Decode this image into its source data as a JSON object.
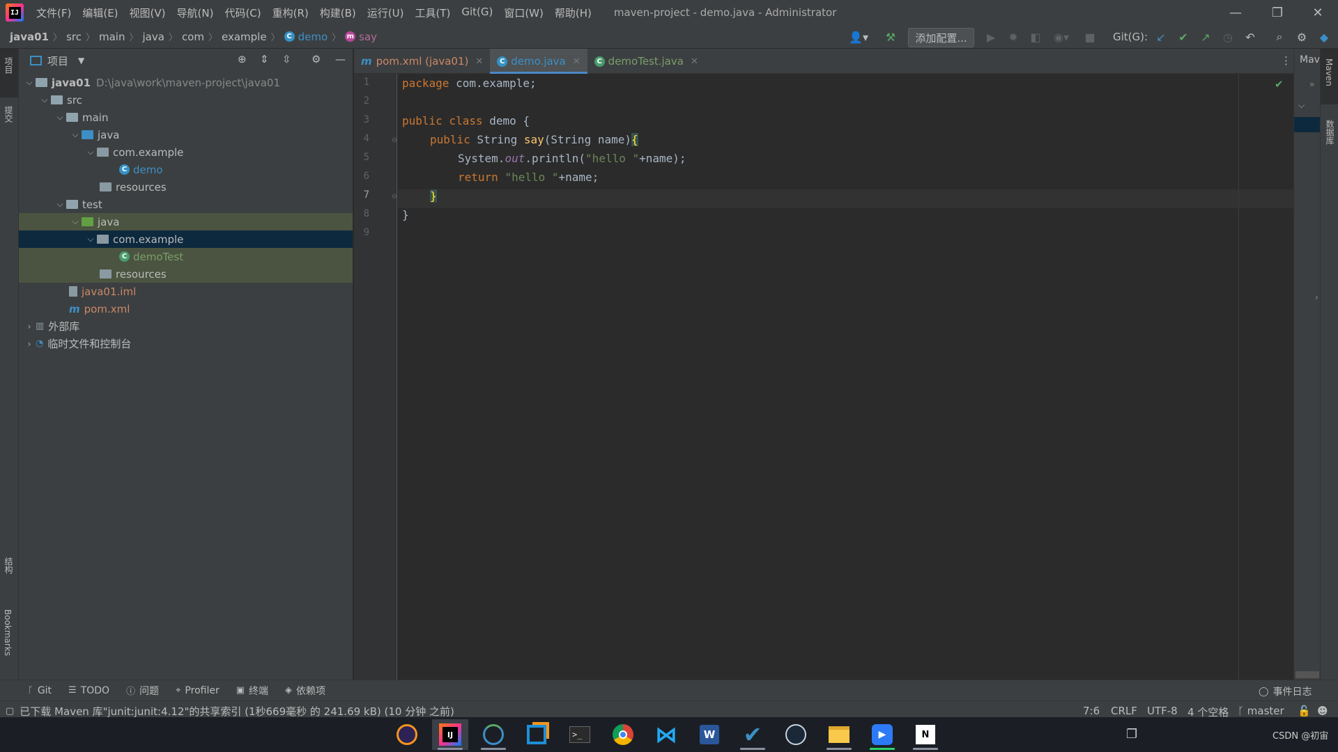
{
  "titlebar": {
    "menu": [
      "文件(F)",
      "编辑(E)",
      "视图(V)",
      "导航(N)",
      "代码(C)",
      "重构(R)",
      "构建(B)",
      "运行(U)",
      "工具(T)",
      "Git(G)",
      "窗口(W)",
      "帮助(H)"
    ],
    "title": "maven-project - demo.java - Administrator"
  },
  "navbar": {
    "crumbs": [
      "java01",
      "src",
      "main",
      "java",
      "com",
      "example",
      "demo",
      "say"
    ],
    "add_config": "添加配置...",
    "git_label": "Git(G):"
  },
  "leftstrip": {
    "labels": [
      "项目",
      "提交",
      "结构",
      "Bookmarks"
    ]
  },
  "project": {
    "title": "项目",
    "tree": [
      {
        "label": "java01",
        "extra": "D:\\java\\work\\maven-project\\java01"
      },
      {
        "label": "src"
      },
      {
        "label": "main"
      },
      {
        "label": "java"
      },
      {
        "label": "com.example"
      },
      {
        "label": "demo"
      },
      {
        "label": "resources"
      },
      {
        "label": "test"
      },
      {
        "label": "java"
      },
      {
        "label": "com.example"
      },
      {
        "label": "demoTest"
      },
      {
        "label": "resources"
      },
      {
        "label": "java01.iml"
      },
      {
        "label": "pom.xml"
      },
      {
        "label": "外部库"
      },
      {
        "label": "临时文件和控制台"
      }
    ]
  },
  "tabs": [
    {
      "label": "pom.xml (java01)"
    },
    {
      "label": "demo.java"
    },
    {
      "label": "demoTest.java"
    }
  ],
  "editor": {
    "line_numbers": [
      "1",
      "2",
      "3",
      "4",
      "5",
      "6",
      "7",
      "8",
      "9"
    ],
    "code": {
      "l1_kw": "package",
      "l1_rest": " com.example;",
      "l3_kw": "public class",
      "l3_rest": " demo {",
      "l4_kw": "public",
      "l4_type": " String ",
      "l4_fn": "say",
      "l4_rest": "(String name)",
      "l4_brace": "{",
      "l5_a": "System.",
      "l5_out": "out",
      "l5_b": ".println(",
      "l5_str": "\"hello \"",
      "l5_c": "+name);",
      "l6_kw": "return",
      "l6_str": " \"hello \"",
      "l6_rest": "+name;",
      "l7": "}",
      "l8": "}"
    }
  },
  "rightpanel": {
    "maven_label": "Mav",
    "strip_labels": [
      "Maven",
      "数据库"
    ]
  },
  "bottom_tools": [
    "Git",
    "TODO",
    "问题",
    "Profiler",
    "终端",
    "依赖项"
  ],
  "event_log": "事件日志",
  "status": {
    "message": "已下载 Maven 库\"junit:junit:4.12\"的共享索引 (1秒669毫秒 的 241.69 kB) (10 分钟 之前)",
    "position": "7:6",
    "line_sep": "CRLF",
    "encoding": "UTF-8",
    "indent": "4 个空格",
    "branch": "master"
  },
  "taskbar": {
    "watermark": "CSDN @初宙"
  }
}
